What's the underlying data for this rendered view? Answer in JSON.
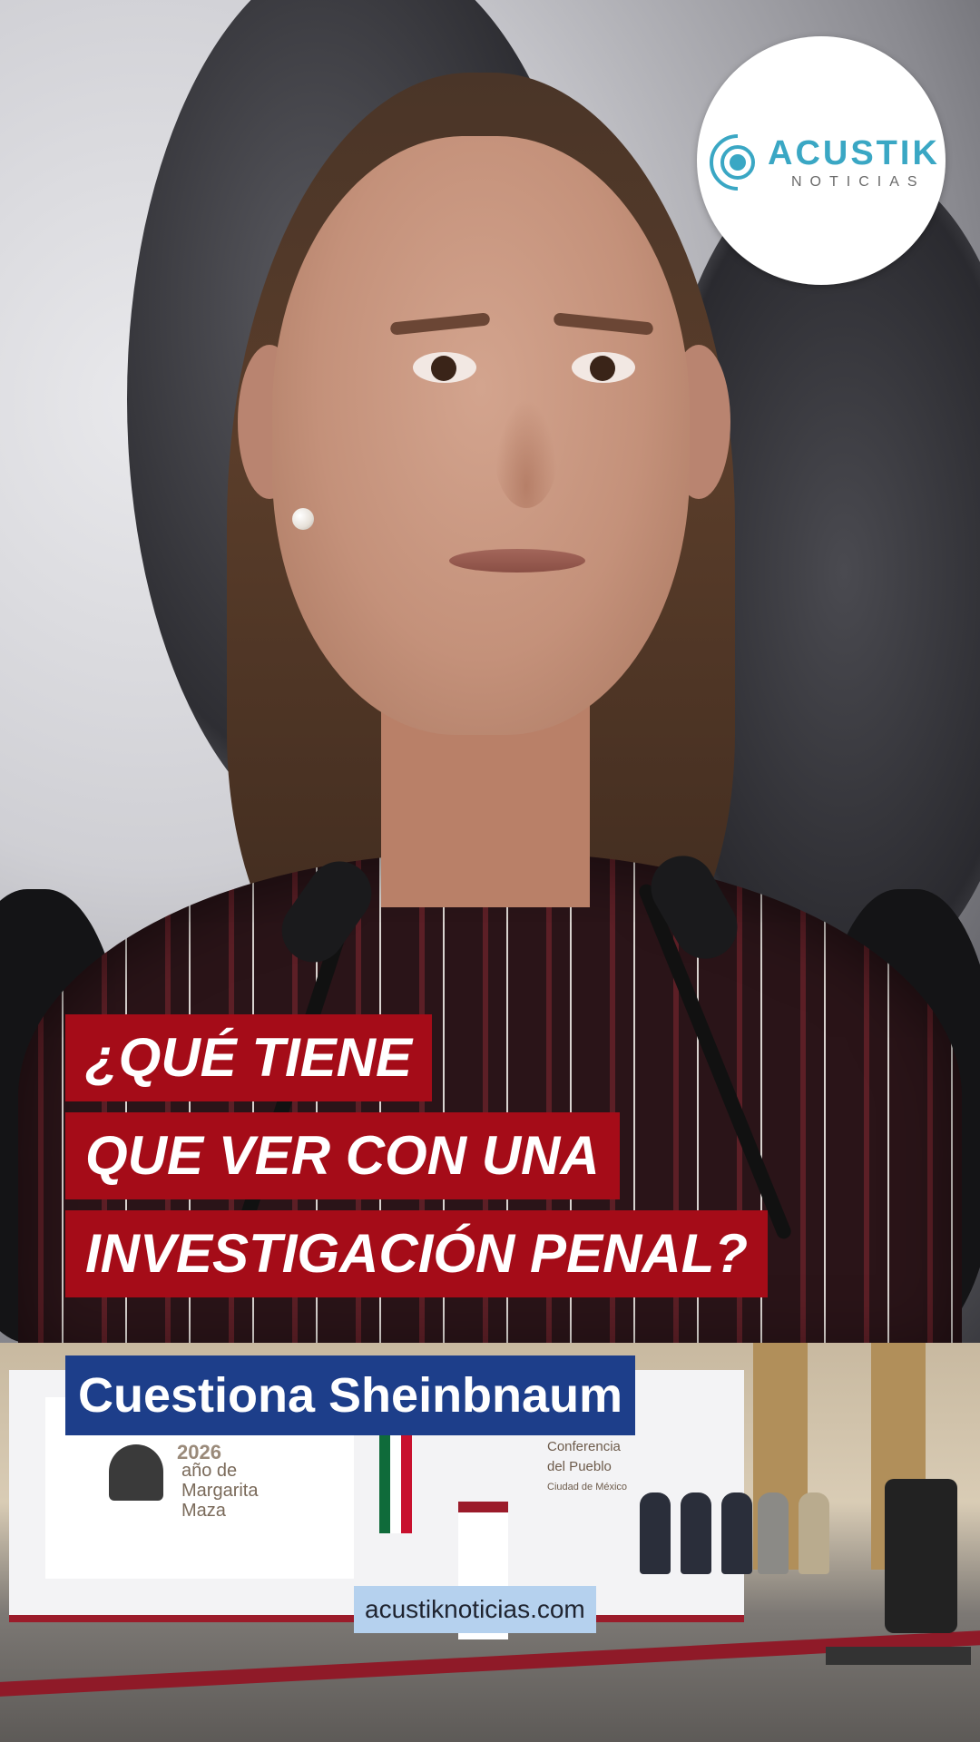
{
  "logo": {
    "title": "ACUSTIK",
    "subtitle": "NOTICIAS",
    "accent_color": "#3aa7c4"
  },
  "headline": {
    "lines": [
      "¿QUÉ TIENE",
      "QUE VER CON UNA",
      "INVESTIGACIÓN PENAL?"
    ],
    "background_color": "#a50c18"
  },
  "lower_third": {
    "text": "Cuestiona Sheinbnaum",
    "background_color": "#1d3e8a"
  },
  "scene_text": {
    "year": "2026",
    "sign_lines": [
      "año de",
      "Margarita",
      "Maza"
    ],
    "conference_lines": [
      "Conferencia",
      "del Pueblo",
      "Ciudad de México"
    ]
  },
  "website": {
    "text": "acustiknoticias.com"
  }
}
